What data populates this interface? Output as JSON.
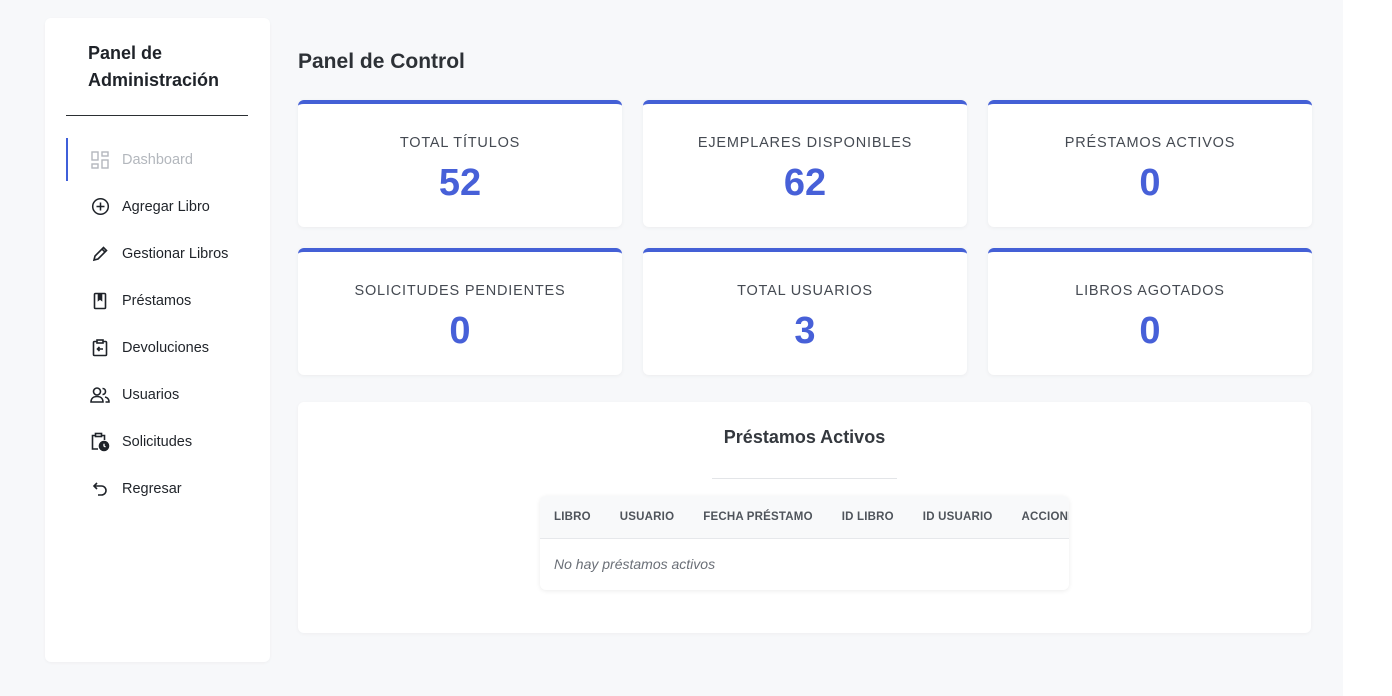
{
  "sidebar": {
    "title": "Panel de Administración",
    "items": [
      {
        "label": "Dashboard",
        "icon": "dashboard-icon",
        "active": true
      },
      {
        "label": "Agregar Libro",
        "icon": "plus-circle-icon"
      },
      {
        "label": "Gestionar Libros",
        "icon": "pencil-icon"
      },
      {
        "label": "Préstamos",
        "icon": "bookmark-book-icon"
      },
      {
        "label": "Devoluciones",
        "icon": "return-clipboard-icon"
      },
      {
        "label": "Usuarios",
        "icon": "users-icon"
      },
      {
        "label": "Solicitudes",
        "icon": "clipboard-clock-icon"
      },
      {
        "label": "Regresar",
        "icon": "undo-arrow-icon"
      }
    ]
  },
  "main": {
    "title": "Panel de Control",
    "stats": [
      {
        "label": "TOTAL TÍTULOS",
        "value": "52"
      },
      {
        "label": "EJEMPLARES DISPONIBLES",
        "value": "62"
      },
      {
        "label": "PRÉSTAMOS ACTIVOS",
        "value": "0"
      },
      {
        "label": "SOLICITUDES PENDIENTES",
        "value": "0"
      },
      {
        "label": "TOTAL USUARIOS",
        "value": "3"
      },
      {
        "label": "LIBROS AGOTADOS",
        "value": "0"
      }
    ],
    "loans": {
      "title": "Préstamos Activos",
      "columns": [
        "LIBRO",
        "USUARIO",
        "FECHA PRÉSTAMO",
        "ID LIBRO",
        "ID USUARIO",
        "ACCIONES"
      ],
      "empty_message": "No hay préstamos activos"
    }
  },
  "colors": {
    "accent": "#4760d8",
    "card_border": "#4460d6",
    "active_indicator": "#3f5fd9"
  }
}
